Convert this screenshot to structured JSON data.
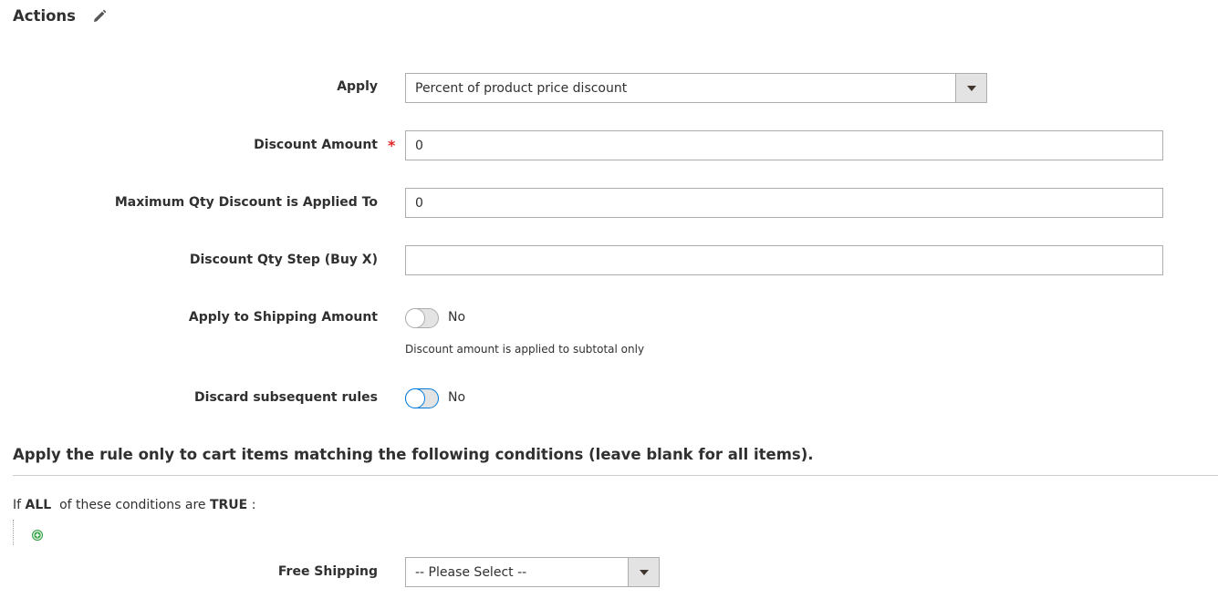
{
  "section": {
    "title": "Actions"
  },
  "form": {
    "apply": {
      "label": "Apply",
      "value": "Percent of product price discount"
    },
    "discount_amount": {
      "label": "Discount Amount",
      "required_mark": "*",
      "value": "0"
    },
    "max_qty": {
      "label": "Maximum Qty Discount is Applied To",
      "value": "0"
    },
    "qty_step": {
      "label": "Discount Qty Step (Buy X)",
      "value": ""
    },
    "apply_shipping": {
      "label": "Apply to Shipping Amount",
      "state_text": "No",
      "note": "Discount amount is applied to subtotal only"
    },
    "discard_rules": {
      "label": "Discard subsequent rules",
      "state_text": "No"
    }
  },
  "conditions": {
    "heading": "Apply the rule only to cart items matching the following conditions (leave blank for all items).",
    "prefix": "If",
    "aggregator": "ALL",
    "middle": "of these conditions are",
    "value": "TRUE",
    "suffix": ":"
  },
  "free_shipping": {
    "label": "Free Shipping",
    "value": "-- Please Select --"
  },
  "icons": {
    "edit": "pencil-icon",
    "dropdown": "caret-down-icon",
    "add": "add-condition-icon"
  },
  "colors": {
    "required": "#e22626",
    "focus": "#007bdb",
    "add_icon": "#2f9e44"
  }
}
